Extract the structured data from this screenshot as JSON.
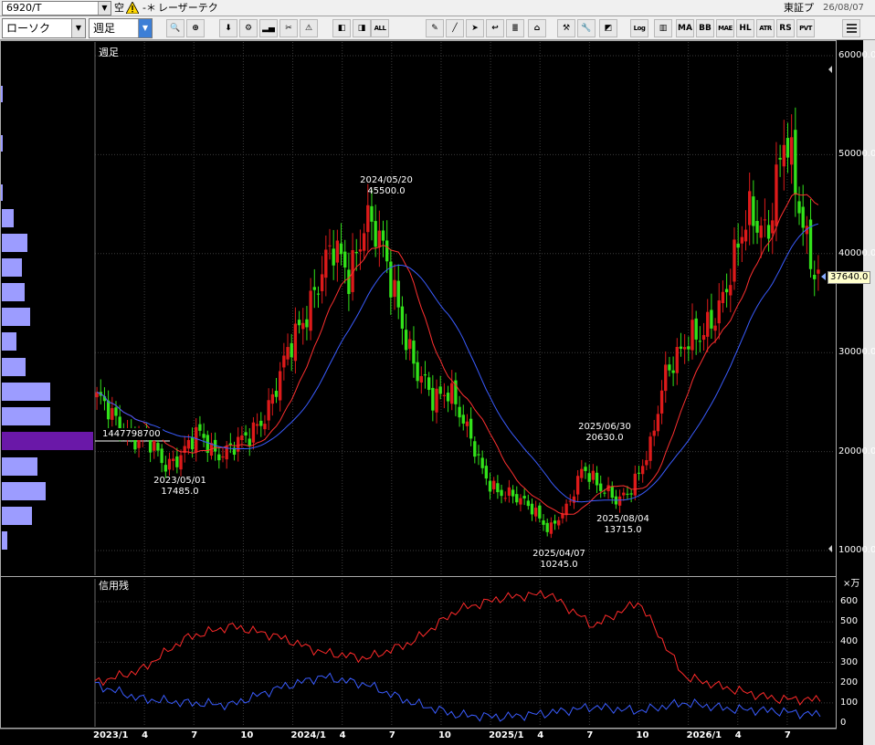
{
  "header": {
    "code": "6920/T",
    "kara_badge": "空",
    "mark": "-＊",
    "company": "レーザーテク",
    "market": "東証プ",
    "date": "26/08/07"
  },
  "toolbar": {
    "chart_type": "ローソク",
    "period": "週足",
    "buttons": [
      {
        "name": "magnify-icon",
        "label": "🔍"
      },
      {
        "name": "zoom-chart-icon",
        "label": "⊕"
      },
      {
        "name": "cursor-down-icon",
        "label": "⬇"
      },
      {
        "name": "gear-icon",
        "label": "⚙"
      },
      {
        "name": "volume-bars-icon",
        "label": "▂▄"
      },
      {
        "name": "scissors-icon",
        "label": "✂"
      },
      {
        "name": "alert-icon",
        "label": "⚠"
      },
      {
        "name": "candle-left-icon",
        "label": "◧"
      },
      {
        "name": "candle-right-icon",
        "label": "◨"
      },
      {
        "name": "all-icon",
        "label": "ALL"
      },
      {
        "name": "pencil-icon",
        "label": "✎"
      },
      {
        "name": "line-tool-icon",
        "label": "╱"
      },
      {
        "name": "arrow-cursor-icon",
        "label": "➤"
      },
      {
        "name": "undo-icon",
        "label": "↩"
      },
      {
        "name": "notes-icon",
        "label": "≣"
      },
      {
        "name": "cylinder-icon",
        "label": "⌂"
      },
      {
        "name": "tools-icon",
        "label": "⚒"
      },
      {
        "name": "wrench-icon",
        "label": "🔧"
      },
      {
        "name": "palette-icon",
        "label": "◩"
      },
      {
        "name": "log-icon",
        "label": "Log"
      },
      {
        "name": "vol-rank-icon",
        "label": "▥"
      },
      {
        "name": "ma-button",
        "label": "MA"
      },
      {
        "name": "bb-button",
        "label": "BB"
      },
      {
        "name": "mave-button",
        "label": "MAE"
      },
      {
        "name": "hl-button",
        "label": "HL"
      },
      {
        "name": "atr-button",
        "label": "ATR"
      },
      {
        "name": "pr-button",
        "label": "RS"
      },
      {
        "name": "pvt-button",
        "label": "PVT"
      }
    ]
  },
  "main_chart": {
    "label": "週足",
    "y_ticks": [
      "60000.0",
      "50000.0",
      "40000.0",
      "30000.0",
      "20000.0",
      "10000.0"
    ],
    "current_price": "37640.0",
    "volume_peak": "1447798700",
    "annotations": [
      {
        "date": "2024/05/20",
        "value": "45500.0"
      },
      {
        "date": "2023/05/01",
        "value": "17485.0"
      },
      {
        "date": "2025/06/30",
        "value": "20630.0"
      },
      {
        "date": "2025/08/04",
        "value": "13715.0"
      },
      {
        "date": "2025/04/07",
        "value": "10245.0"
      }
    ]
  },
  "sub_chart": {
    "label": "信用残",
    "unit": "×万",
    "y_ticks": [
      "600",
      "500",
      "400",
      "300",
      "200",
      "100",
      "0"
    ]
  },
  "date_axis": [
    "2023/1",
    "4",
    "7",
    "10",
    "2024/1",
    "4",
    "7",
    "10",
    "2025/1",
    "4",
    "7",
    "10",
    "2026/1",
    "4",
    "7"
  ],
  "colors": {
    "up_candle": "#dd1a1a",
    "down_candle": "#32e21a",
    "ma_short": "#ff3030",
    "ma_long": "#3a5cff",
    "volume_bar": "#9c9cff",
    "volume_bar_peak": "#6a18a8",
    "margin_buy": "#ff2a2a",
    "margin_sell": "#3a5cff"
  },
  "chart_data": {
    "type": "candlestick",
    "title": "週足",
    "x_ticks": [
      "2023/1",
      "4",
      "7",
      "10",
      "2024/1",
      "4",
      "7",
      "10",
      "2025/1",
      "4",
      "7",
      "10",
      "2026/1",
      "4",
      "7"
    ],
    "ylim": [
      10000,
      60000
    ],
    "series": [
      {
        "name": "close",
        "points": [
          [
            "2023/01",
            25500
          ],
          [
            "2023/02",
            23000
          ],
          [
            "2023/03",
            22000
          ],
          [
            "2023/04",
            21000
          ],
          [
            "2023/05",
            18500
          ],
          [
            "2023/06",
            20000
          ],
          [
            "2023/07",
            21500
          ],
          [
            "2023/08",
            20000
          ],
          [
            "2023/09",
            20500
          ],
          [
            "2023/10",
            21000
          ],
          [
            "2023/11",
            24000
          ],
          [
            "2023/12",
            28000
          ],
          [
            "2024/01",
            32000
          ],
          [
            "2024/02",
            37000
          ],
          [
            "2024/03",
            40000
          ],
          [
            "2024/04",
            38000
          ],
          [
            "2024/05",
            44000
          ],
          [
            "2024/06",
            40000
          ],
          [
            "2024/07",
            35000
          ],
          [
            "2024/08",
            28000
          ],
          [
            "2024/09",
            25000
          ],
          [
            "2024/10",
            27000
          ],
          [
            "2024/11",
            22000
          ],
          [
            "2024/12",
            18000
          ],
          [
            "2025/01",
            16000
          ],
          [
            "2025/02",
            15000
          ],
          [
            "2025/03",
            14500
          ],
          [
            "2025/04",
            12000
          ],
          [
            "2025/05",
            14000
          ],
          [
            "2025/06",
            19000
          ],
          [
            "2025/07",
            16000
          ],
          [
            "2025/08",
            15000
          ],
          [
            "2025/09",
            17000
          ],
          [
            "2025/10",
            20000
          ],
          [
            "2025/11",
            29000
          ],
          [
            "2025/12",
            31000
          ],
          [
            "2026/01",
            31000
          ],
          [
            "2026/02",
            35000
          ],
          [
            "2026/03",
            39000
          ],
          [
            "2026/04",
            44000
          ],
          [
            "2026/05",
            43000
          ],
          [
            "2026/06",
            51000
          ],
          [
            "2026/07",
            44000
          ],
          [
            "2026/08",
            37640
          ]
        ]
      },
      {
        "name": "margin_buy",
        "values": [
          200,
          260,
          420,
          480,
          430,
          350,
          320,
          400,
          560,
          620,
          640,
          480,
          600,
          230,
          170,
          120,
          115
        ]
      },
      {
        "name": "margin_sell",
        "values": [
          190,
          120,
          100,
          90,
          170,
          230,
          190,
          100,
          40,
          30,
          50,
          80,
          60,
          100,
          70,
          60,
          40
        ]
      }
    ],
    "annotations": [
      {
        "date": "2024/05/20",
        "value": 45500,
        "kind": "high"
      },
      {
        "date": "2023/05/01",
        "value": 17485,
        "kind": "low"
      },
      {
        "date": "2025/06/30",
        "value": 20630,
        "kind": "high"
      },
      {
        "date": "2025/08/04",
        "value": 13715,
        "kind": "low"
      },
      {
        "date": "2025/04/07",
        "value": 10245,
        "kind": "low"
      }
    ]
  }
}
